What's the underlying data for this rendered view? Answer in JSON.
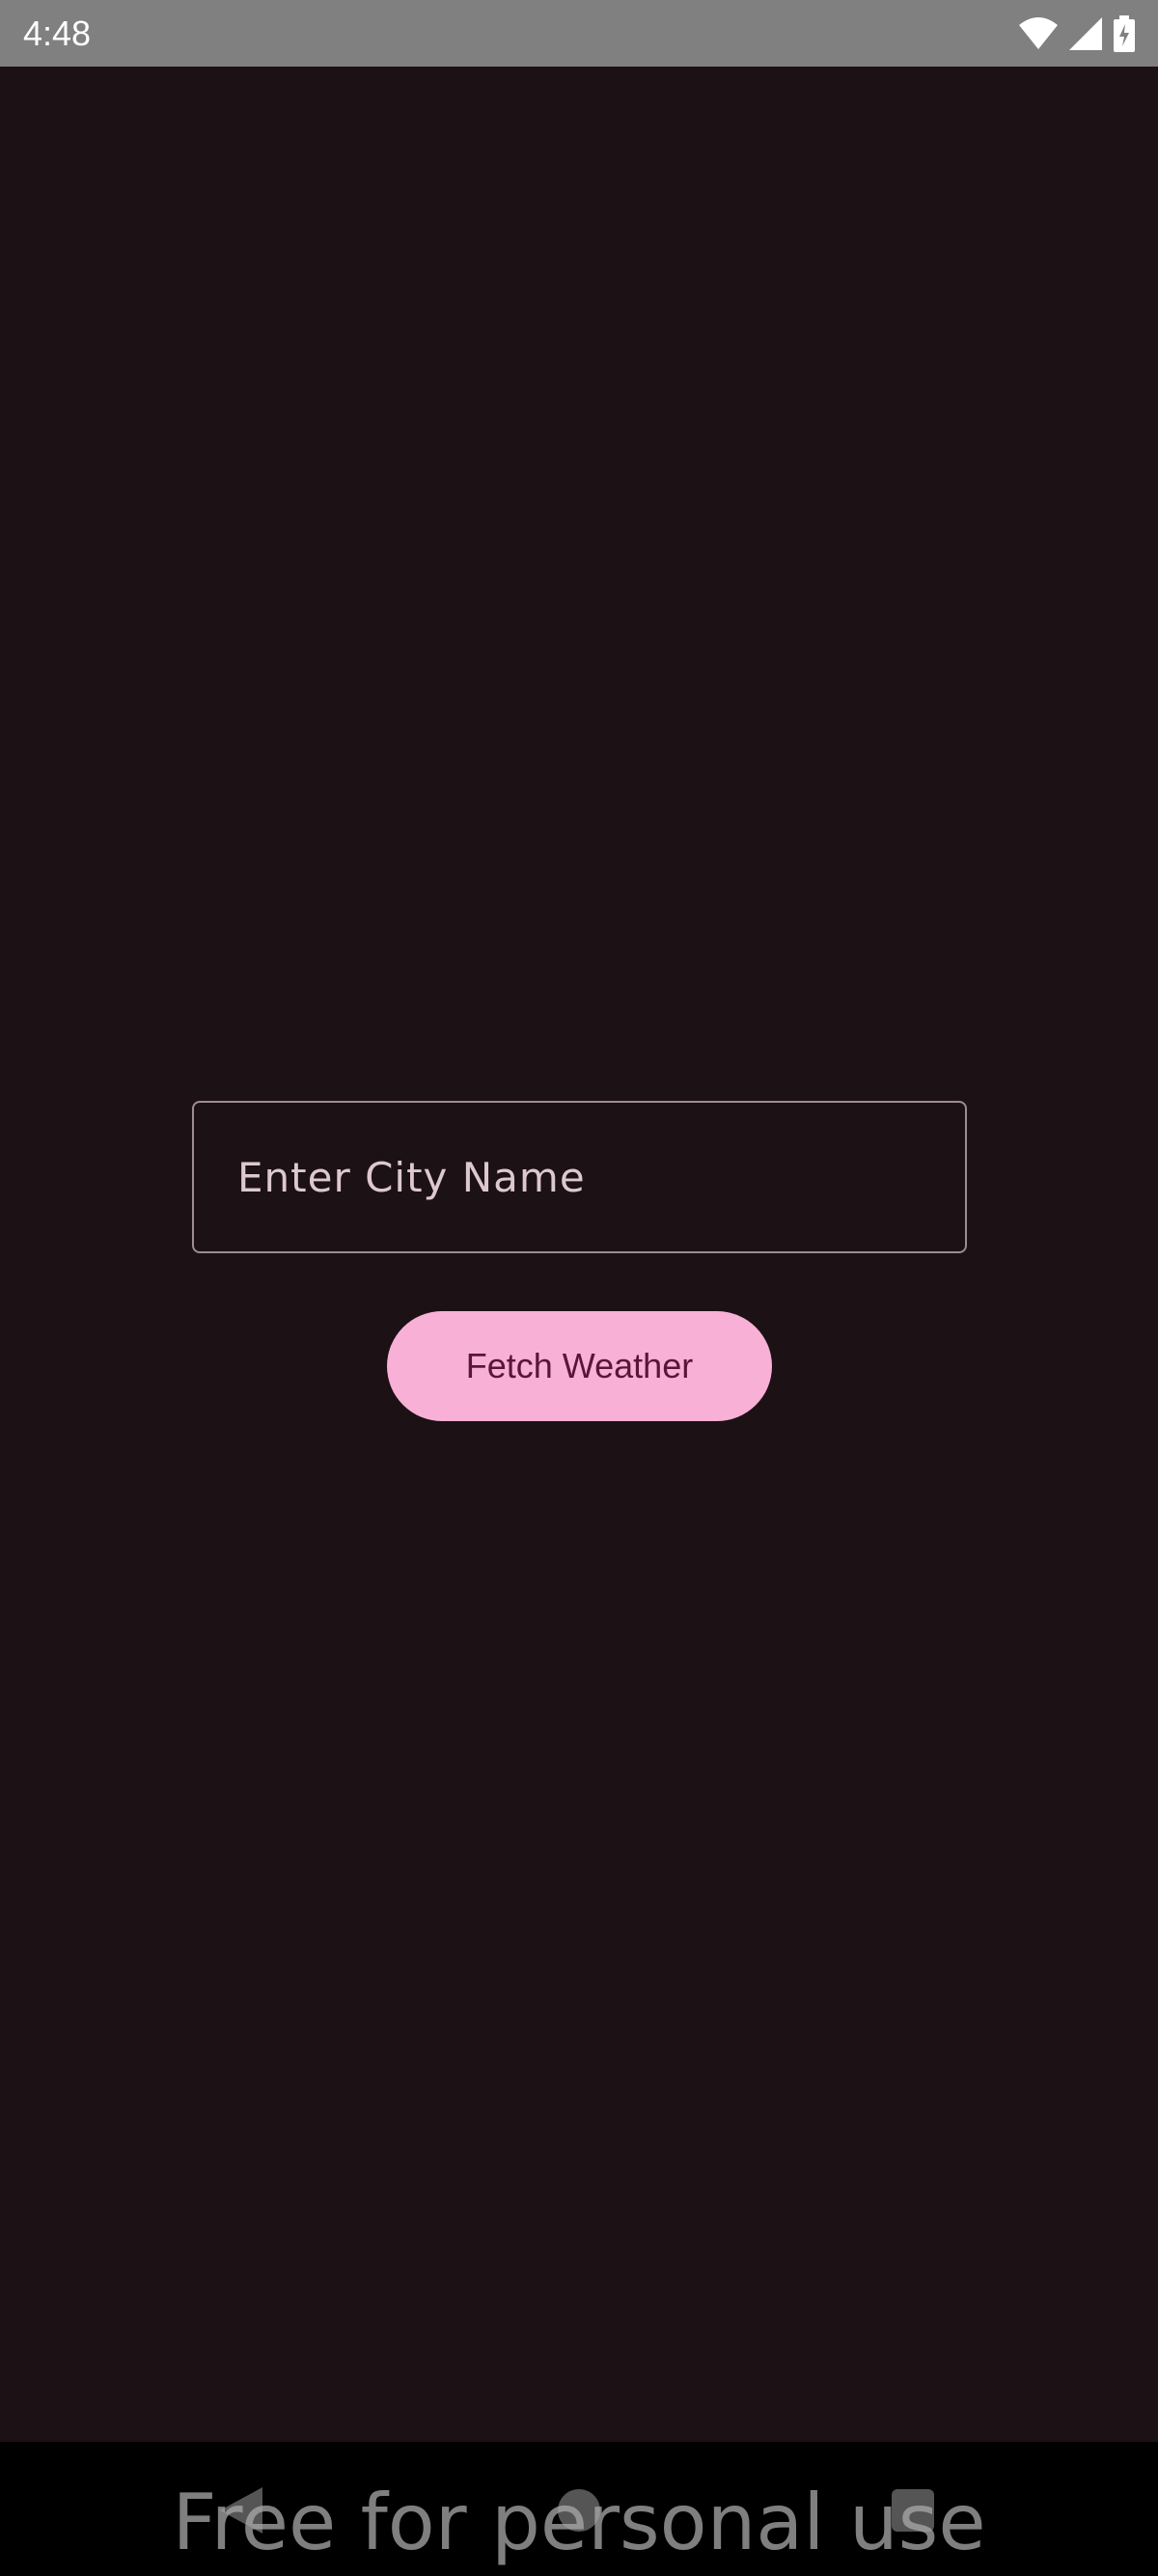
{
  "status_bar": {
    "time": "4:48",
    "icons": [
      "wifi-icon",
      "cellular-signal-icon",
      "battery-charging-icon"
    ]
  },
  "city_input": {
    "value": "",
    "placeholder": "Enter City Name"
  },
  "fetch_button": {
    "label": "Fetch Weather"
  },
  "nav_bar": {
    "icons": [
      "back-icon",
      "home-icon",
      "recents-icon"
    ]
  },
  "watermark": {
    "text": "Free for personal use"
  },
  "colors": {
    "background": "#1c1115",
    "status_bar": "#808080",
    "field_border": "#9e8c92",
    "button_bg": "#f8b0d6",
    "button_text": "#5a1538",
    "nav_bar": "#000000"
  }
}
